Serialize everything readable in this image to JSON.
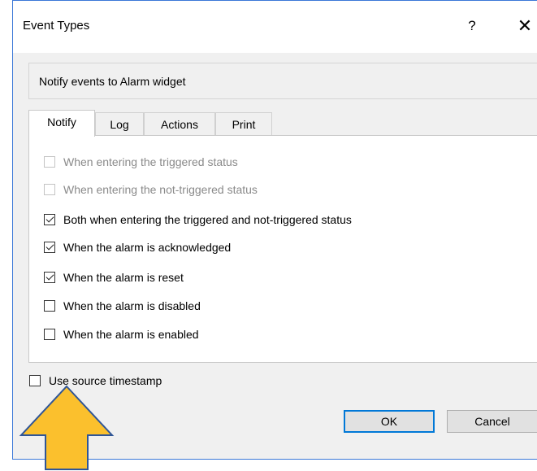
{
  "window": {
    "title": "Event Types",
    "help_label": "?",
    "close_label": "✕"
  },
  "description": "Notify events to Alarm widget",
  "tabs": [
    {
      "label": "Notify",
      "active": true
    },
    {
      "label": "Log",
      "active": false
    },
    {
      "label": "Actions",
      "active": false
    },
    {
      "label": "Print",
      "active": false
    }
  ],
  "notify_options": [
    {
      "label": "When entering the triggered status",
      "checked": false,
      "enabled": false
    },
    {
      "label": "When entering the not-triggered status",
      "checked": false,
      "enabled": false
    },
    {
      "label": "Both when entering the triggered and not-triggered status",
      "checked": true,
      "enabled": true
    },
    {
      "label": "When the alarm is acknowledged",
      "checked": true,
      "enabled": true
    },
    {
      "label": "When the alarm is reset",
      "checked": true,
      "enabled": true
    },
    {
      "label": "When the alarm is disabled",
      "checked": false,
      "enabled": true
    },
    {
      "label": "When the alarm is enabled",
      "checked": false,
      "enabled": true
    }
  ],
  "source_timestamp": {
    "label": "Use source timestamp",
    "checked": false
  },
  "buttons": {
    "ok": "OK",
    "cancel": "Cancel"
  },
  "colors": {
    "accent_border": "#3b78d8",
    "default_button_border": "#0078d7",
    "arrow_fill": "#fbc02d",
    "arrow_stroke": "#2f5597"
  }
}
